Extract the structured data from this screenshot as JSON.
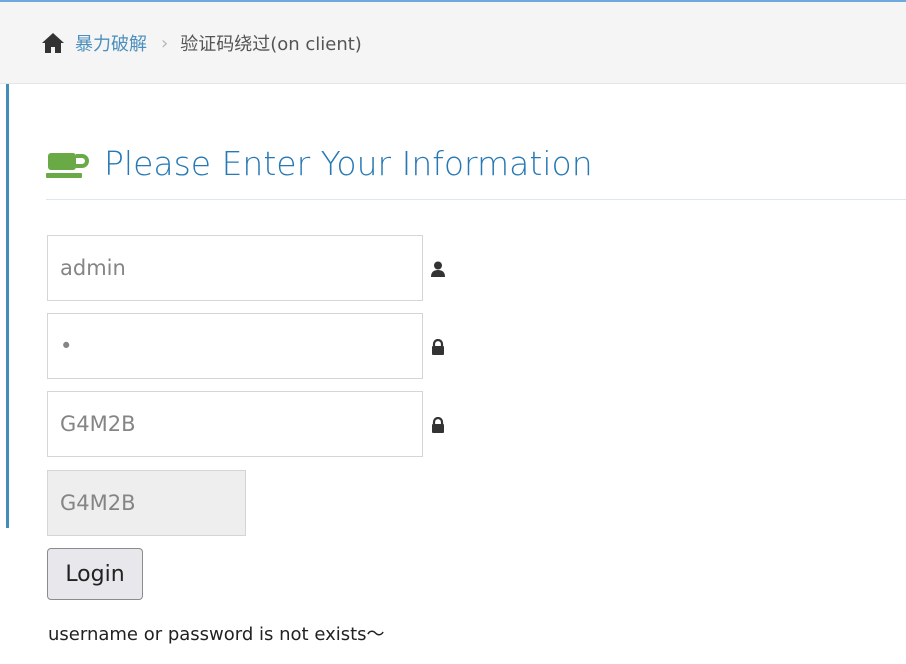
{
  "breadcrumb": {
    "home_link": "暴力破解",
    "separator": "›",
    "current": "验证码绕过(on client)"
  },
  "header": {
    "title": "Please Enter Your Information"
  },
  "form": {
    "username_value": "admin",
    "password_value": "•",
    "captcha_input_value": "G4M2B",
    "captcha_display": "G4M2B",
    "login_label": "Login"
  },
  "message": {
    "text": "username or password is not exists～"
  },
  "icons": {
    "home": "home-icon",
    "title": "coffee-cup-icon",
    "username": "user-icon",
    "password": "lock-icon",
    "captcha": "lock-icon"
  },
  "colors": {
    "link": "#4c8fbd",
    "title": "#2679b5",
    "cup": "#69aa46",
    "accent_bar": "#438eb9"
  }
}
